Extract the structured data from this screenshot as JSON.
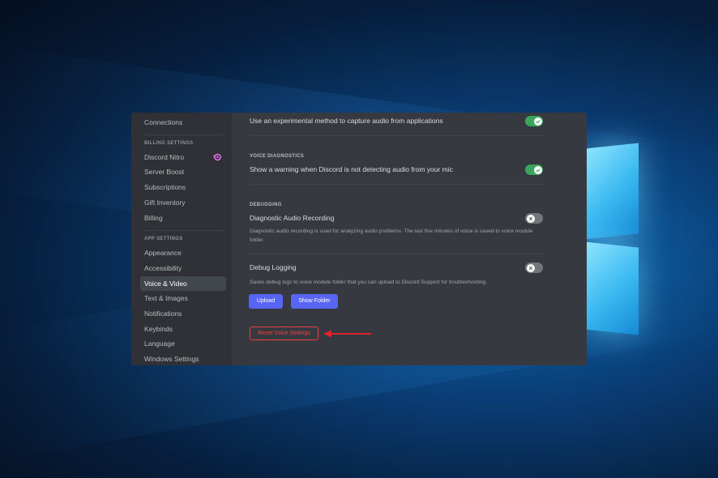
{
  "sidebar": {
    "connections": "Connections",
    "billing_header": "BILLING SETTINGS",
    "billing_items": [
      "Discord Nitro",
      "Server Boost",
      "Subscriptions",
      "Gift Inventory",
      "Billing"
    ],
    "app_header": "APP SETTINGS",
    "app_items": [
      "Appearance",
      "Accessibility",
      "Voice & Video",
      "Text & Images",
      "Notifications",
      "Keybinds",
      "Language",
      "Windows Settings"
    ],
    "active_item": "Voice & Video"
  },
  "content": {
    "experimental_capture": {
      "label": "Use an experimental method to capture audio from applications",
      "enabled": true
    },
    "voice_diagnostics": {
      "header": "VOICE DIAGNOSTICS",
      "label": "Show a warning when Discord is not detecting audio from your mic",
      "enabled": true
    },
    "debugging": {
      "header": "DEBUGGING",
      "diagnostic_recording": {
        "label": "Diagnostic Audio Recording",
        "description": "Diagnostic audio recording is used for analyzing audio problems. The last five minutes of voice is saved to voice module folder.",
        "enabled": false
      },
      "debug_logging": {
        "label": "Debug Logging",
        "description": "Saves debug logs to voice module folder that you can upload to Discord Support for troubleshooting.",
        "enabled": false
      },
      "upload_label": "Upload",
      "show_folder_label": "Show Folder"
    },
    "reset_label": "Reset Voice Settings"
  },
  "colors": {
    "accent": "#5865f2",
    "toggle_on": "#3ba55d",
    "toggle_off": "#72767d",
    "danger": "#ed4245",
    "annotation_arrow": "#e0242a"
  },
  "icons": [
    "nitro-icon",
    "check-icon",
    "x-icon",
    "arrow-annotation"
  ]
}
